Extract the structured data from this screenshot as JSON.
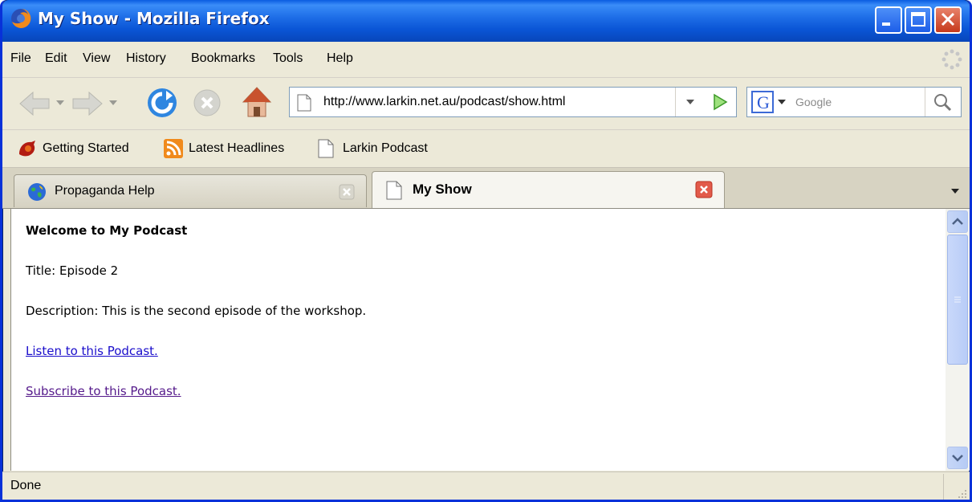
{
  "window": {
    "title": "My Show - Mozilla Firefox",
    "controls": [
      "minimize",
      "maximize",
      "close"
    ]
  },
  "menubar": {
    "items": [
      "File",
      "Edit",
      "View",
      "History",
      "Bookmarks",
      "Tools",
      "Help"
    ]
  },
  "navigation": {
    "url": "http://www.larkin.net.au/podcast/show.html",
    "search_engine": "G",
    "search_placeholder": "Google"
  },
  "bookmarks": {
    "items": [
      "Getting Started",
      "Latest Headlines",
      "Larkin Podcast"
    ]
  },
  "tabs": [
    {
      "label": "Propaganda Help",
      "active": false
    },
    {
      "label": "My Show",
      "active": true
    }
  ],
  "page": {
    "heading": "Welcome to My Podcast",
    "title_line": "Title: Episode 2",
    "description_line": "Description: This is the second episode of the workshop.",
    "listen_link": "Listen to this Podcast.",
    "subscribe_link": "Subscribe to this Podcast."
  },
  "status": {
    "text": "Done"
  },
  "colors": {
    "titlebar": "#0a55d6",
    "link": "#1a0dcb",
    "visited_link": "#551a8b",
    "chrome": "#ece9d8"
  }
}
